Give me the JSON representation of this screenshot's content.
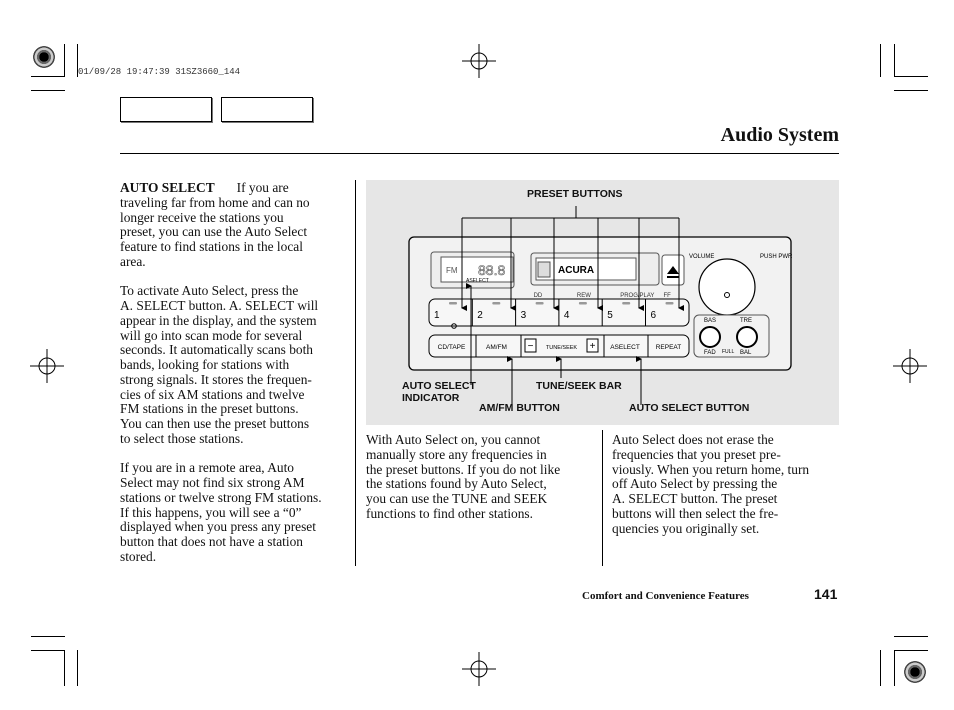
{
  "print_stamp": "01/09/28 19:47:39 31SZ3660_144",
  "header": {
    "title": "Audio System"
  },
  "left_column": {
    "heading": "AUTO SELECT",
    "paragraphs": [
      [
        "If you are",
        "traveling far from home and can no",
        "longer receive the stations you",
        "preset, you can use the Auto Select",
        "feature to find stations in the local",
        "area."
      ],
      [
        "To activate Auto Select, press the",
        "A. SELECT button. A. SELECT will",
        "appear in the display, and the system",
        "will go into scan mode for several",
        "seconds. It automatically scans both",
        "bands, looking for stations with",
        "strong signals. It stores the frequen-",
        "cies of six AM stations and twelve",
        "FM stations in the preset buttons.",
        "You can then use the preset buttons",
        "to select those stations."
      ],
      [
        "If you are in a remote area, Auto",
        "Select may not find six strong AM",
        "stations or twelve strong FM stations.",
        "If this happens, you will see a “0”",
        "displayed when you press any preset",
        "button that does not have a station",
        "stored."
      ]
    ]
  },
  "middle_column": {
    "lines": [
      "With Auto Select on, you cannot",
      "manually store any frequencies in",
      "the preset buttons. If you do not like",
      "the stations found by Auto Select,",
      "you can use the TUNE and SEEK",
      "functions to find other stations."
    ]
  },
  "right_column": {
    "lines": [
      "Auto Select does not erase the",
      "frequencies that you preset pre-",
      "viously. When you return home, turn",
      "off Auto Select by pressing the",
      "A. SELECT button. The preset",
      "buttons will then select the fre-",
      "quencies you originally set."
    ]
  },
  "diagram": {
    "callouts": {
      "preset_buttons": "PRESET BUTTONS",
      "auto_select_indicator": [
        "AUTO SELECT",
        "INDICATOR"
      ],
      "tune_seek_bar": "TUNE/SEEK BAR",
      "am_fm_button": "AM/FM BUTTON",
      "auto_select_button": "AUTO SELECT BUTTON"
    },
    "radio": {
      "display_band": "FM",
      "display_digits": "88.8",
      "display_indicator": "ASELECT",
      "brand": "ACURA",
      "volume": "VOLUME",
      "push_pwr": "PUSH PWR",
      "preset_labels": [
        "1",
        "2",
        "3",
        "4",
        "5",
        "6"
      ],
      "preset_top_labels": [
        "",
        "",
        "DD",
        "REW",
        "PROG/PLAY",
        "FF"
      ],
      "bottom_buttons": [
        "CD/TAPE",
        "AM/FM",
        "TUNE/SEEK",
        "ASELECT",
        "REPEAT"
      ],
      "knob_labels": [
        "BAS",
        "TRE",
        "FAD",
        "FULL",
        "BAL"
      ]
    }
  },
  "footer": {
    "section": "Comfort and Convenience Features",
    "page_number": "141"
  }
}
